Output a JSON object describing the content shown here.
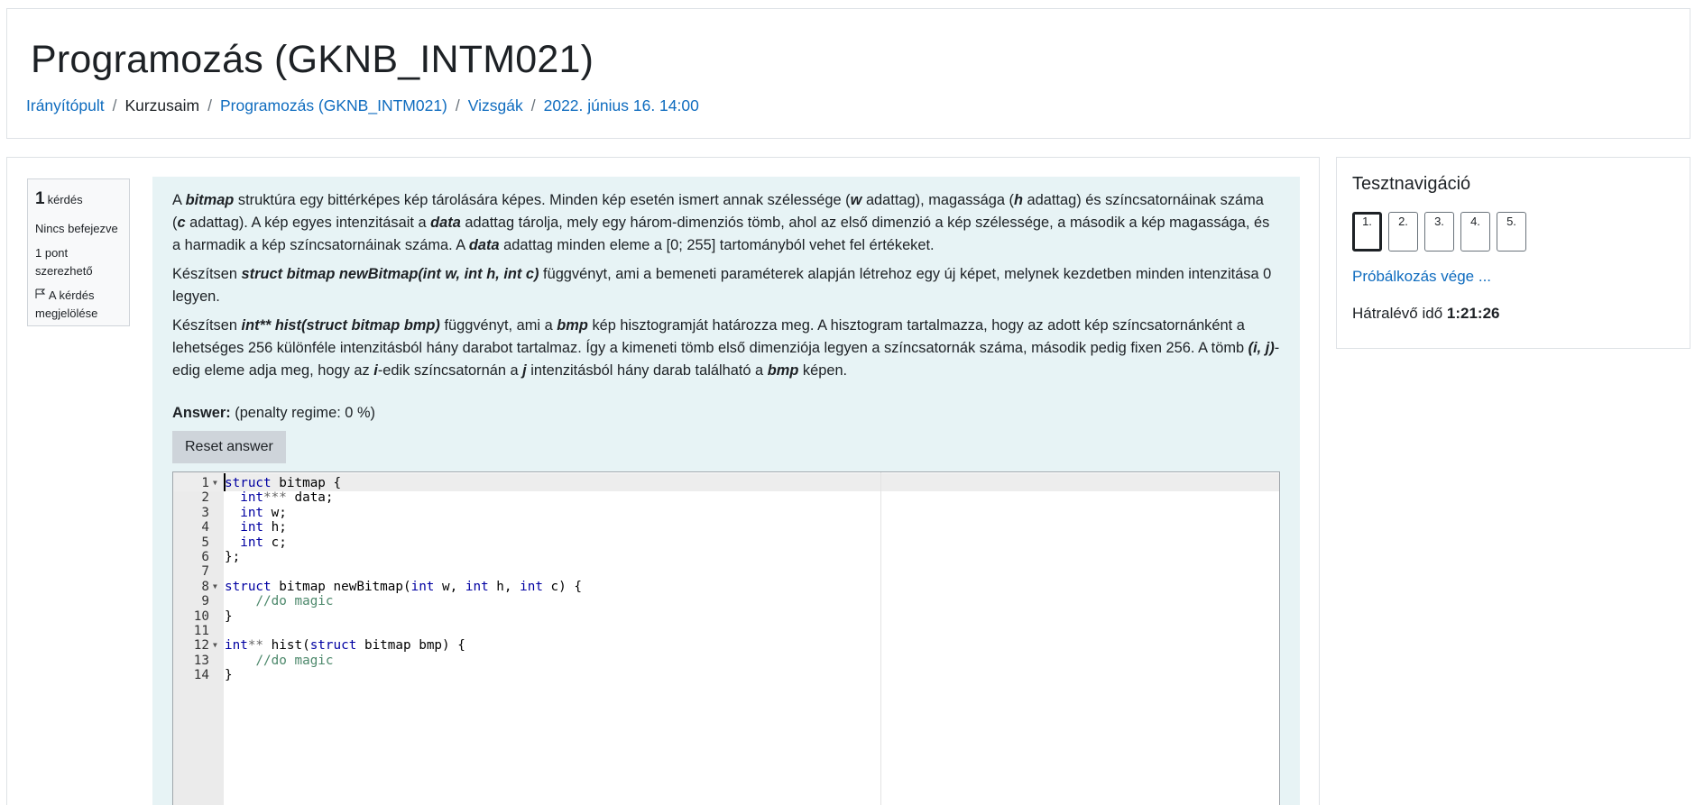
{
  "header": {
    "title": "Programozás (GKNB_INTM021)",
    "breadcrumb": [
      {
        "label": "Irányítópult",
        "link": true
      },
      {
        "label": "Kurzusaim",
        "link": false
      },
      {
        "label": "Programozás (GKNB_INTM021)",
        "link": true
      },
      {
        "label": "Vizsgák",
        "link": true
      },
      {
        "label": "2022. június 16. 14:00",
        "link": true
      }
    ],
    "separator": "/"
  },
  "question_info": {
    "number": "1",
    "number_label": "kérdés",
    "state": "Nincs befejezve",
    "grade": "1 pont szerezhető",
    "flag_label": "A kérdés megjelölése"
  },
  "question": {
    "p1": {
      "t1": "A ",
      "b1": "bitmap",
      "t2": " struktúra egy bittérképes kép tárolására képes. Minden kép esetén ismert annak szélessége (",
      "b2": "w",
      "t3": " adattag), magassága (",
      "b3": "h",
      "t4": " adattag) és színcsatornáinak száma (",
      "b4": "c",
      "t5": " adattag). A kép egyes intenzitásait a ",
      "b5": "data",
      "t6": " adattag tárolja, mely egy három-dimenziós tömb, ahol az első dimenzió a kép szélessége, a második a kép magassága, és a harmadik a kép színcsatornáinak száma. A ",
      "b6": "data",
      "t7": " adattag minden eleme a [0; 255] tartományból vehet fel értékeket."
    },
    "p2": {
      "t1": "Készítsen ",
      "b1": "struct bitmap newBitmap(int w, int h, int c)",
      "t2": " függvényt, ami a bemeneti paraméterek alapján létrehoz egy új képet, melynek kezdetben minden intenzitása 0 legyen."
    },
    "p3": {
      "t1": "Készítsen ",
      "b1": "int** hist(struct bitmap bmp)",
      "t2": " függvényt, ami a ",
      "b2": "bmp",
      "t3": " kép hisztogramját határozza meg. A hisztogram tartalmazza, hogy az adott kép színcsatornánként a lehetséges 256 különféle intenzitásból hány darabot tartalmaz. Így a kimeneti tömb első dimenziója legyen a színcsatornák száma, második pedig fixen 256. A tömb ",
      "b3": "(i, j)",
      "t4": "-edig eleme adja meg, hogy az ",
      "b4": "i",
      "t5": "-edik színcsatornán a ",
      "b5": "j",
      "t6": " intenzitásból hány darab található a ",
      "b6": "bmp",
      "t7": " képen."
    },
    "answer_label": "Answer:",
    "penalty": "(penalty regime: 0 %)",
    "reset_label": "Reset answer"
  },
  "code_lines": [
    "struct bitmap {",
    "  int*** data;",
    "  int w;",
    "  int h;",
    "  int c;",
    "};",
    "",
    "struct bitmap newBitmap(int w, int h, int c) {",
    "    //do magic",
    "}",
    "",
    "int** hist(struct bitmap bmp) {",
    "    //do magic",
    "}"
  ],
  "fold_lines": [
    1,
    8,
    12
  ],
  "quiz_nav": {
    "title": "Tesztnavigáció",
    "buttons": [
      "1.",
      "2.",
      "3.",
      "4.",
      "5."
    ],
    "current": 0,
    "finish_label": "Próbálkozás vége ...",
    "time_label": "Hátralévő idő",
    "time_value": "1:21:26"
  }
}
